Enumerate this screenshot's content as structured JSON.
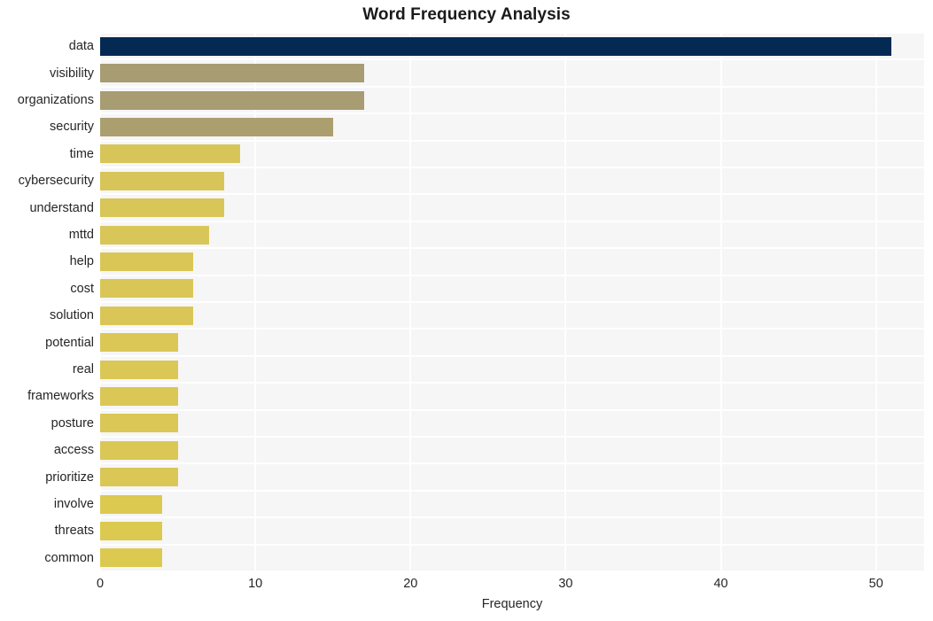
{
  "chart": {
    "title": "Word Frequency Analysis",
    "xlabel": "Frequency",
    "ylabel": ""
  },
  "chart_data": {
    "type": "bar",
    "orientation": "horizontal",
    "title": "Word Frequency Analysis",
    "xlabel": "Frequency",
    "ylabel": "",
    "xlim": [
      0,
      53.1
    ],
    "xticks": [
      0,
      10,
      20,
      30,
      40,
      50
    ],
    "xtick_labels": [
      "0",
      "10",
      "20",
      "30",
      "40",
      "50"
    ],
    "grid": true,
    "legend": "none",
    "categories": [
      "data",
      "visibility",
      "organizations",
      "security",
      "time",
      "cybersecurity",
      "understand",
      "mttd",
      "help",
      "cost",
      "solution",
      "potential",
      "real",
      "frameworks",
      "posture",
      "access",
      "prioritize",
      "involve",
      "threats",
      "common"
    ],
    "values": [
      51,
      17,
      17,
      15,
      9,
      8,
      8,
      7,
      6,
      6,
      6,
      5,
      5,
      5,
      5,
      5,
      5,
      4,
      4,
      4
    ],
    "bar_colors": [
      "#042a54",
      "#a79c72",
      "#a79c72",
      "#ac9f6f",
      "#d7c559",
      "#d7c559",
      "#d8c658",
      "#d8c658",
      "#d9c657",
      "#d9c657",
      "#d9c657",
      "#dac755",
      "#dac755",
      "#dac755",
      "#dac755",
      "#dac755",
      "#dac755",
      "#dcc94f",
      "#dcc94f",
      "#dcc94f"
    ]
  },
  "style": {
    "plot_background": "#f6f6f7",
    "figure_background": "#ffffff",
    "gridline_color": "#ffffff",
    "text_color": "#262626",
    "title_color": "#1a1a1a"
  }
}
